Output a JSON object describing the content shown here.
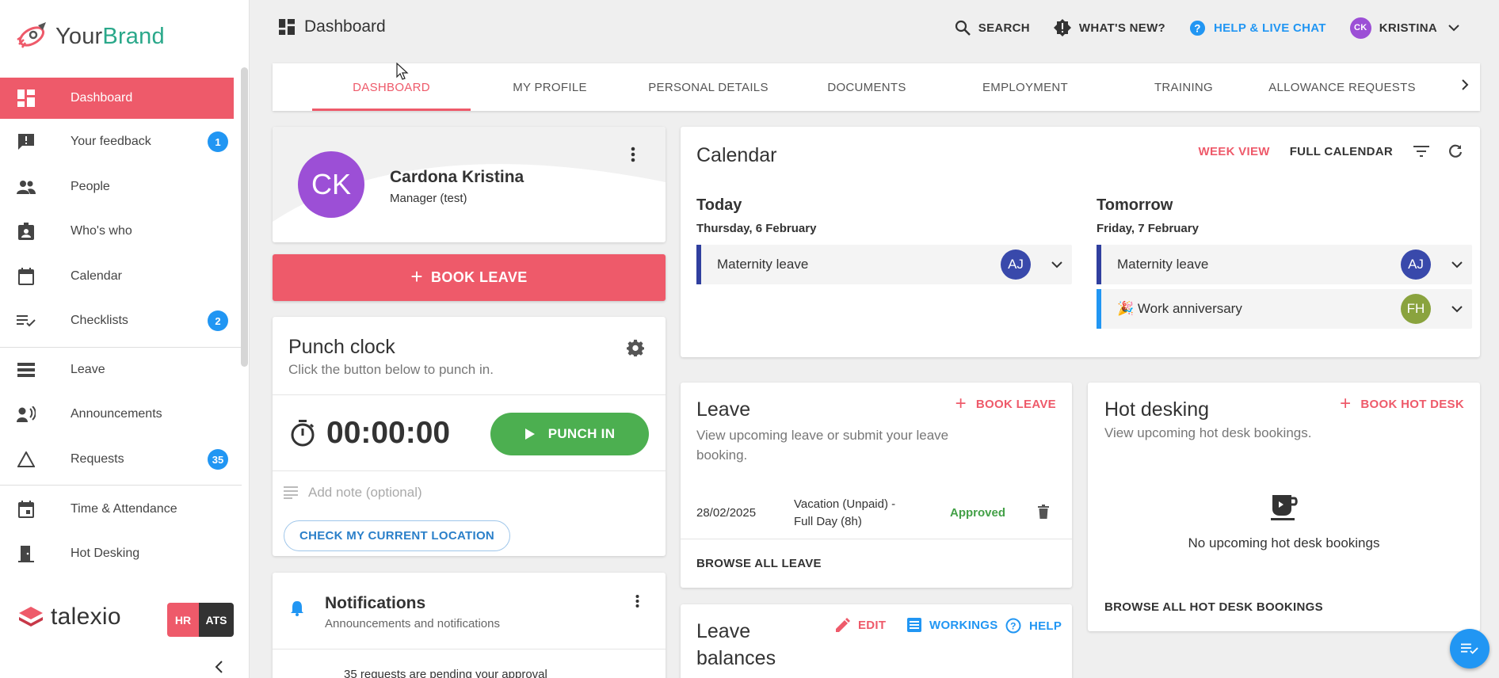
{
  "brand": {
    "name_main": "Your",
    "name_accent": "Brand"
  },
  "sidebar": {
    "items": [
      {
        "label": "Dashboard",
        "icon": "dashboard-icon",
        "badge": ""
      },
      {
        "label": "Your feedback",
        "icon": "feedback-icon",
        "badge": "1"
      },
      {
        "label": "People",
        "icon": "people-icon",
        "badge": ""
      },
      {
        "label": "Who's who",
        "icon": "badge-icon",
        "badge": ""
      },
      {
        "label": "Calendar",
        "icon": "calendar-icon",
        "badge": ""
      },
      {
        "label": "Checklists",
        "icon": "checklist-icon",
        "badge": "2"
      },
      {
        "label": "Leave",
        "icon": "leave-icon",
        "badge": ""
      },
      {
        "label": "Announcements",
        "icon": "announcement-icon",
        "badge": ""
      },
      {
        "label": "Requests",
        "icon": "requests-icon",
        "badge": "35"
      },
      {
        "label": "Time & Attendance",
        "icon": "time-icon",
        "badge": ""
      },
      {
        "label": "Hot Desking",
        "icon": "door-icon",
        "badge": ""
      }
    ],
    "footer_brand": "talexio",
    "hr_label": "HR",
    "ats_label": "ATS",
    "collapse_label": "‹"
  },
  "topbar": {
    "title": "Dashboard",
    "search_label": "SEARCH",
    "whats_new_label": "WHAT'S NEW?",
    "help_label": "HELP & LIVE CHAT",
    "user_initials": "CK",
    "user_name": "KRISTINA"
  },
  "tabs": [
    {
      "label": "DASHBOARD",
      "active": true
    },
    {
      "label": "MY PROFILE",
      "active": false
    },
    {
      "label": "PERSONAL DETAILS",
      "active": false
    },
    {
      "label": "DOCUMENTS",
      "active": false
    },
    {
      "label": "EMPLOYMENT",
      "active": false
    },
    {
      "label": "TRAINING",
      "active": false
    },
    {
      "label": "ALLOWANCE REQUESTS",
      "active": false
    }
  ],
  "profile": {
    "initials": "CK",
    "name": "Cardona Kristina",
    "role": "Manager (test)"
  },
  "book_leave_big": {
    "plus": "+",
    "label": "BOOK LEAVE"
  },
  "punch": {
    "title": "Punch clock",
    "subtitle": "Click the button below to punch in.",
    "timer": "00:00:00",
    "button": "PUNCH IN",
    "note_placeholder": "Add note (optional)",
    "location_button": "CHECK MY CURRENT LOCATION"
  },
  "notifications": {
    "title": "Notifications",
    "subtitle": "Announcements and notifications",
    "pending": "35 requests are pending your approval"
  },
  "calendar": {
    "title": "Calendar",
    "week_view": "WEEK VIEW",
    "full_calendar": "FULL CALENDAR",
    "today": {
      "heading": "Today",
      "date": "Thursday, 6 February",
      "events": [
        {
          "label": "Maternity leave",
          "initials": "AJ"
        }
      ]
    },
    "tomorrow": {
      "heading": "Tomorrow",
      "date": "Friday, 7 February",
      "events": [
        {
          "label": "Maternity leave",
          "initials": "AJ"
        },
        {
          "label": "🎉 Work anniversary",
          "initials": "FH"
        }
      ]
    },
    "colors": {
      "leave_bar": "#303f9f",
      "anniversary_bar": "#2196f3",
      "aj_avatar": "#3949ab",
      "fh_avatar": "#8aa33e"
    }
  },
  "leave": {
    "title": "Leave",
    "book_plus": "+",
    "book_label": "BOOK LEAVE",
    "subtitle": "View upcoming leave or submit your leave booking.",
    "row": {
      "date": "28/02/2025",
      "type_line1": "Vacation (Unpaid) -",
      "type_line2": "Full Day (8h)",
      "status": "Approved"
    },
    "browse": "BROWSE ALL LEAVE"
  },
  "balances": {
    "title_line1": "Leave",
    "title_line2": "balances",
    "edit": "EDIT",
    "workings": "WORKINGS",
    "help": "HELP"
  },
  "hotdesk": {
    "title": "Hot desking",
    "book_plus": "+",
    "book_label": "BOOK HOT DESK",
    "subtitle": "View upcoming hot desk bookings.",
    "empty": "No upcoming hot desk bookings",
    "browse": "BROWSE ALL HOT DESK BOOKINGS"
  },
  "colors": {
    "accent": "#ee5a6a",
    "brand_green": "#2aa88a",
    "blue": "#2196f3",
    "green": "#4caf50",
    "purple": "#9c4fd6"
  }
}
